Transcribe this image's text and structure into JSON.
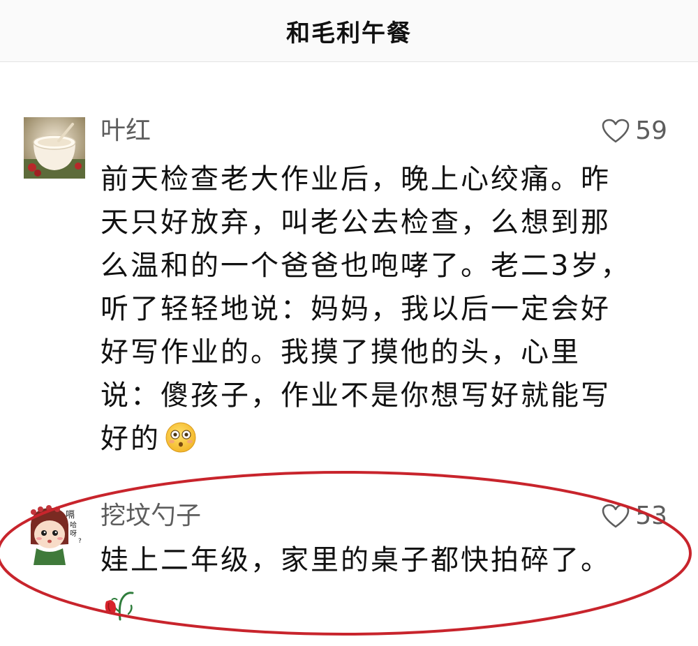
{
  "header": {
    "title": "和毛利午餐"
  },
  "comments": [
    {
      "author": "叶红",
      "likes": "59",
      "lines": [
        "前天检查老大作业后，晚上心绞痛。昨",
        "天只好放弃，叫老公去检查，么想到那",
        "么温和的一个爸爸也咆哮了。老二3岁，",
        "听了轻轻地说：妈妈，我以后一定会好",
        "好写作业的。我摸了摸他的头，心里",
        "说：傻孩子，作业不是你想写好就能写",
        "好的"
      ],
      "emoji": "flushed-face-emoji"
    },
    {
      "author": "挖坟勺子",
      "likes": "53",
      "lines": [
        "娃上二年级，家里的桌子都快拍碎了。"
      ],
      "emoji": "wilted-rose-emoji",
      "avatar_text": [
        "嗝",
        "哈",
        "呀",
        "?"
      ]
    }
  ],
  "colors": {
    "highlight_oval": "#c8242c",
    "meta_text": "#5d5d5d",
    "body_text": "#111111"
  }
}
